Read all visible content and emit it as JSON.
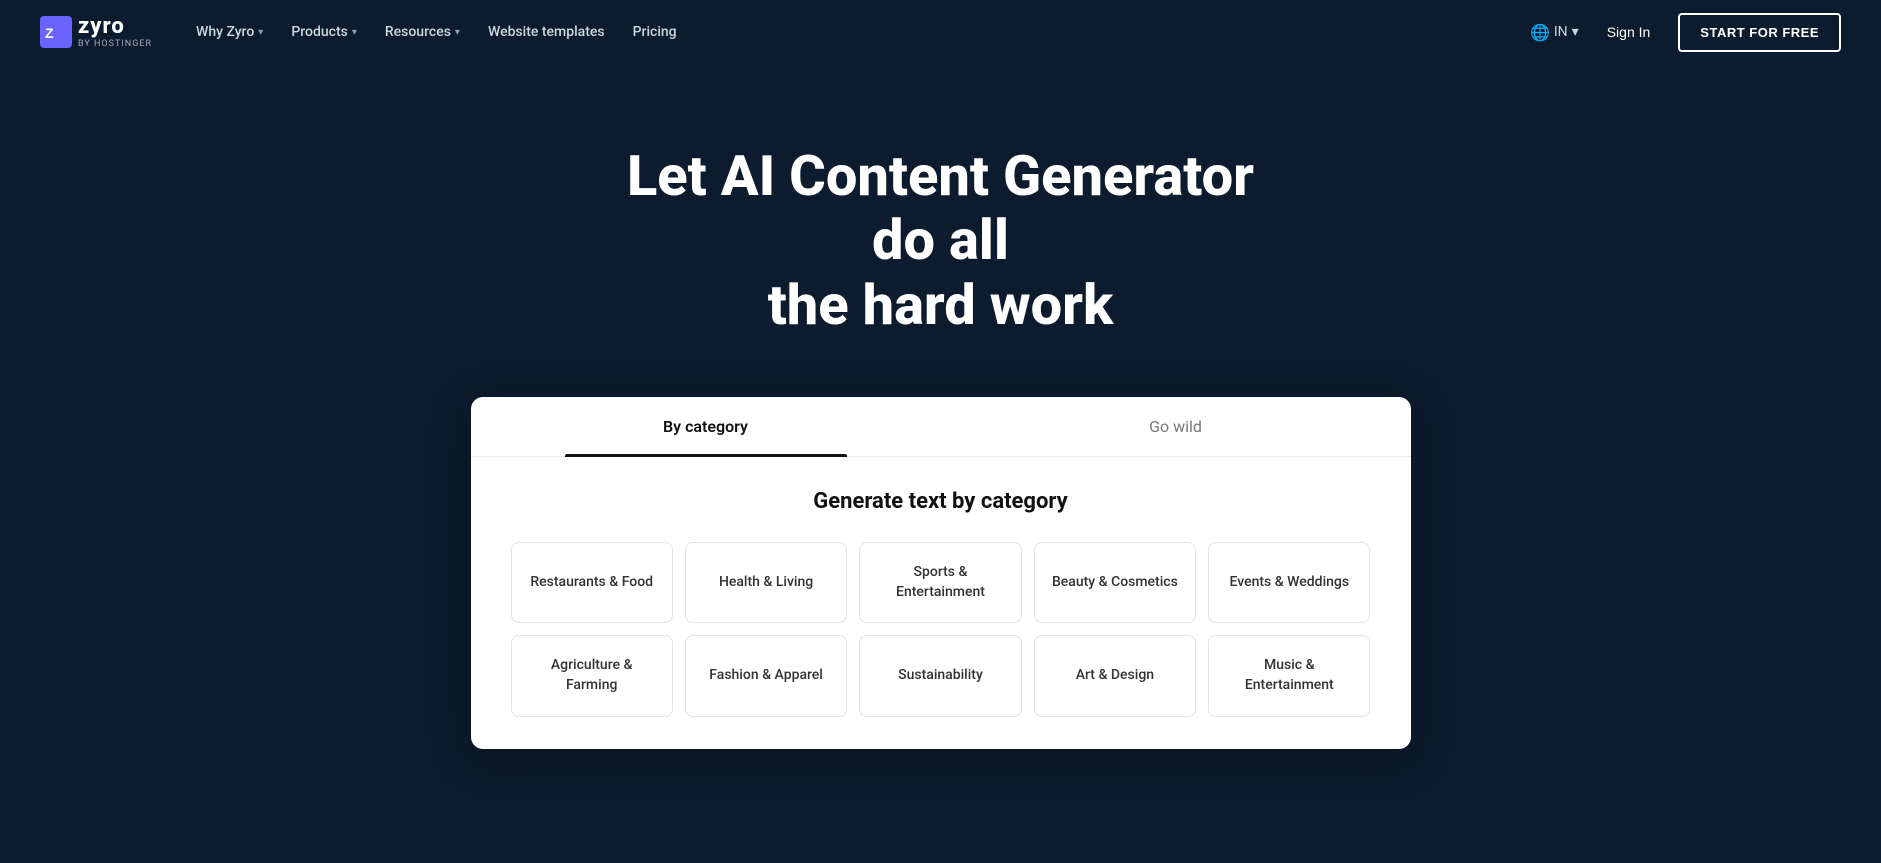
{
  "brand": {
    "name": "zyro",
    "sub": "BY HOSTINGER"
  },
  "navbar": {
    "items": [
      {
        "label": "Why Zyro",
        "hasDropdown": true
      },
      {
        "label": "Products",
        "hasDropdown": true
      },
      {
        "label": "Resources",
        "hasDropdown": true
      },
      {
        "label": "Website templates",
        "hasDropdown": false
      },
      {
        "label": "Pricing",
        "hasDropdown": false
      }
    ],
    "locale": "IN",
    "signIn": "Sign In",
    "startBtn": "START FOR FREE"
  },
  "hero": {
    "title_line1": "Let AI Content Generator do all",
    "title_line2": "the hard work"
  },
  "card": {
    "tabs": [
      {
        "label": "By category",
        "active": true
      },
      {
        "label": "Go wild",
        "active": false
      }
    ],
    "sectionTitle": "Generate text by category",
    "categories": [
      {
        "label": "Restaurants & Food"
      },
      {
        "label": "Health & Living"
      },
      {
        "label": "Sports & Entertainment"
      },
      {
        "label": "Beauty & Cosmetics"
      },
      {
        "label": "Events & Weddings"
      },
      {
        "label": "Agriculture & Farming"
      },
      {
        "label": "Fashion & Apparel"
      },
      {
        "label": "Sustainability"
      },
      {
        "label": "Art & Design"
      },
      {
        "label": "Music & Entertainment"
      }
    ]
  }
}
